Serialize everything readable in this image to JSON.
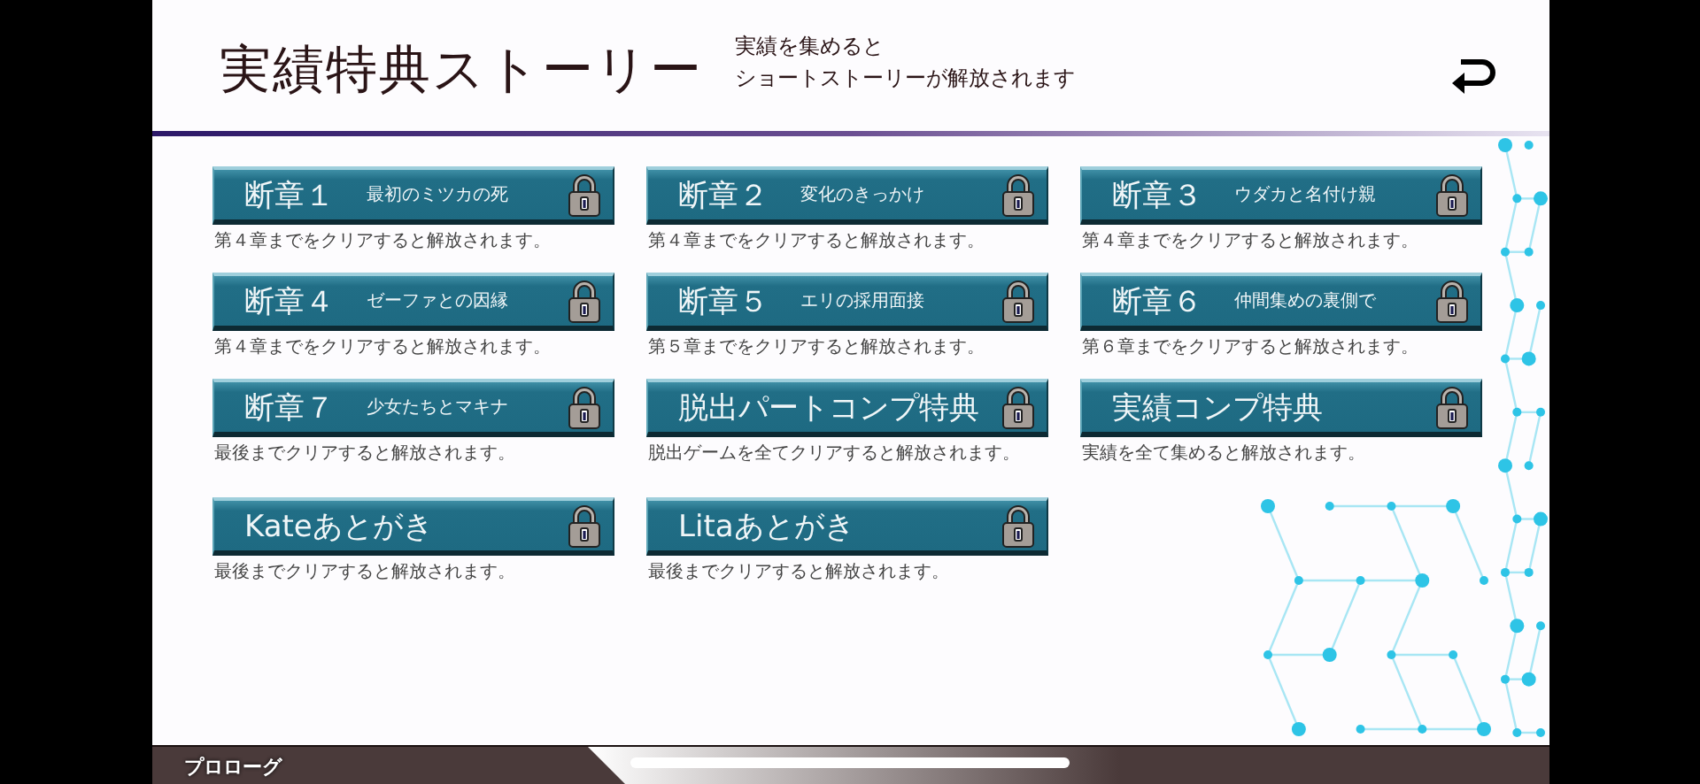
{
  "header": {
    "title": "実績特典ストーリー",
    "subtitle_lines": [
      "実績を集めると",
      "ショートストーリーが解放されます"
    ]
  },
  "stories": [
    {
      "kind": "chapter",
      "label": "断章１",
      "subtitle": "最初のミツカの死",
      "locked": true,
      "condition": "第４章までをクリアすると解放されます。"
    },
    {
      "kind": "chapter",
      "label": "断章２",
      "subtitle": "変化のきっかけ",
      "locked": true,
      "condition": "第４章までをクリアすると解放されます。"
    },
    {
      "kind": "chapter",
      "label": "断章３",
      "subtitle": "ウダカと名付け親",
      "locked": true,
      "condition": "第４章までをクリアすると解放されます。"
    },
    {
      "kind": "chapter",
      "label": "断章４",
      "subtitle": "ゼーファとの因縁",
      "locked": true,
      "condition": "第４章までをクリアすると解放されます。"
    },
    {
      "kind": "chapter",
      "label": "断章５",
      "subtitle": "エリの採用面接",
      "locked": true,
      "condition": "第５章までをクリアすると解放されます。"
    },
    {
      "kind": "chapter",
      "label": "断章６",
      "subtitle": "仲間集めの裏側で",
      "locked": true,
      "condition": "第６章までをクリアすると解放されます。"
    },
    {
      "kind": "chapter",
      "label": "断章７",
      "subtitle": "少女たちとマキナ",
      "locked": true,
      "condition": "最後までクリアすると解放されます。"
    },
    {
      "kind": "single",
      "label": "脱出パートコンプ特典",
      "locked": true,
      "condition": "脱出ゲームを全てクリアすると解放されます。"
    },
    {
      "kind": "single",
      "label": "実績コンプ特典",
      "locked": true,
      "condition": "実績を全て集めると解放されます。"
    },
    {
      "kind": "single",
      "label": "Kateあとがき",
      "locked": true,
      "condition": "最後までクリアすると解放されます。"
    },
    {
      "kind": "single",
      "label": "Litaあとがき",
      "locked": true,
      "condition": "最後までクリアすると解放されます。"
    }
  ],
  "bottom_bar": {
    "label": "プロローグ"
  }
}
